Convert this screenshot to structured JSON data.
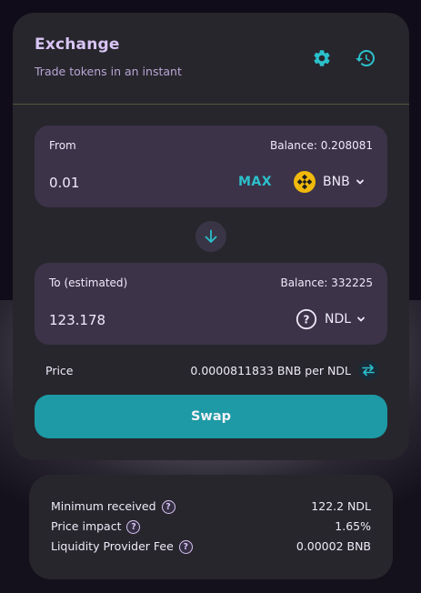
{
  "header": {
    "title": "Exchange",
    "subtitle": "Trade tokens in an instant",
    "settings_icon": "gear-icon",
    "history_icon": "history-icon"
  },
  "from": {
    "label": "From",
    "balance": "Balance: 0.208081",
    "amount": "0.01",
    "max_label": "MAX",
    "token": "BNB",
    "token_icon": "bnb-logo-icon"
  },
  "to": {
    "label": "To (estimated)",
    "balance": "Balance: 332225",
    "amount": "123.178",
    "token": "NDL",
    "token_icon": "question-circle-icon"
  },
  "price": {
    "label": "Price",
    "value": "0.0000811833 BNB per NDL"
  },
  "swap_label": "Swap",
  "details": [
    {
      "label": "Minimum received",
      "value": "122.2 NDL"
    },
    {
      "label": "Price impact",
      "value": "1.65%"
    },
    {
      "label": "Liquidity Provider Fee",
      "value": "0.00002 BNB"
    }
  ],
  "colors": {
    "accent": "#2bc0cc",
    "swap_button": "#1d9aa5",
    "title": "#d9c5f5",
    "panel": "#3c3349",
    "card": "#27262c",
    "bnb": "#f0b90b"
  }
}
